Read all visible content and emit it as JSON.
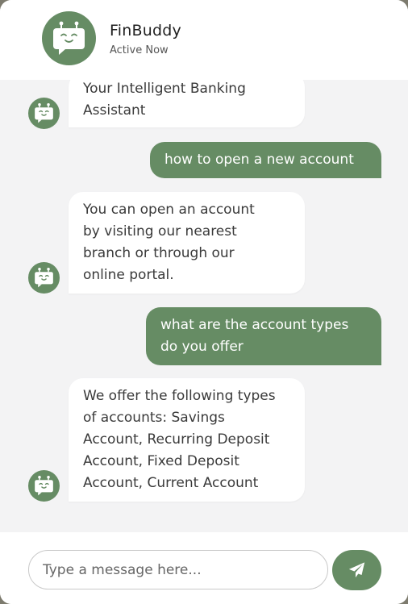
{
  "header": {
    "bot_name": "FinBuddy",
    "status": "Active Now"
  },
  "messages": [
    {
      "sender": "bot",
      "lines": [
        "Your Intelligent Banking",
        "Assistant"
      ]
    },
    {
      "sender": "user",
      "lines": [
        "how to open a new account"
      ]
    },
    {
      "sender": "bot",
      "lines": [
        "You can open an account",
        "by visiting our nearest",
        "branch or through our",
        "online portal."
      ]
    },
    {
      "sender": "user",
      "lines": [
        "what are the account types",
        "do you offer"
      ]
    },
    {
      "sender": "bot",
      "lines": [
        "We offer the following types",
        "of accounts: Savings",
        "Account, Recurring Deposit",
        "Account, Fixed Deposit",
        "Account, Current Account"
      ]
    }
  ],
  "input": {
    "placeholder": "Type a message here..."
  },
  "icons": {
    "bot_avatar": "robot-face-icon",
    "send": "paper-plane-icon"
  },
  "colors": {
    "accent": "#668c64",
    "bubble_bot": "#ffffff",
    "chat_background": "#f3f3f4"
  }
}
